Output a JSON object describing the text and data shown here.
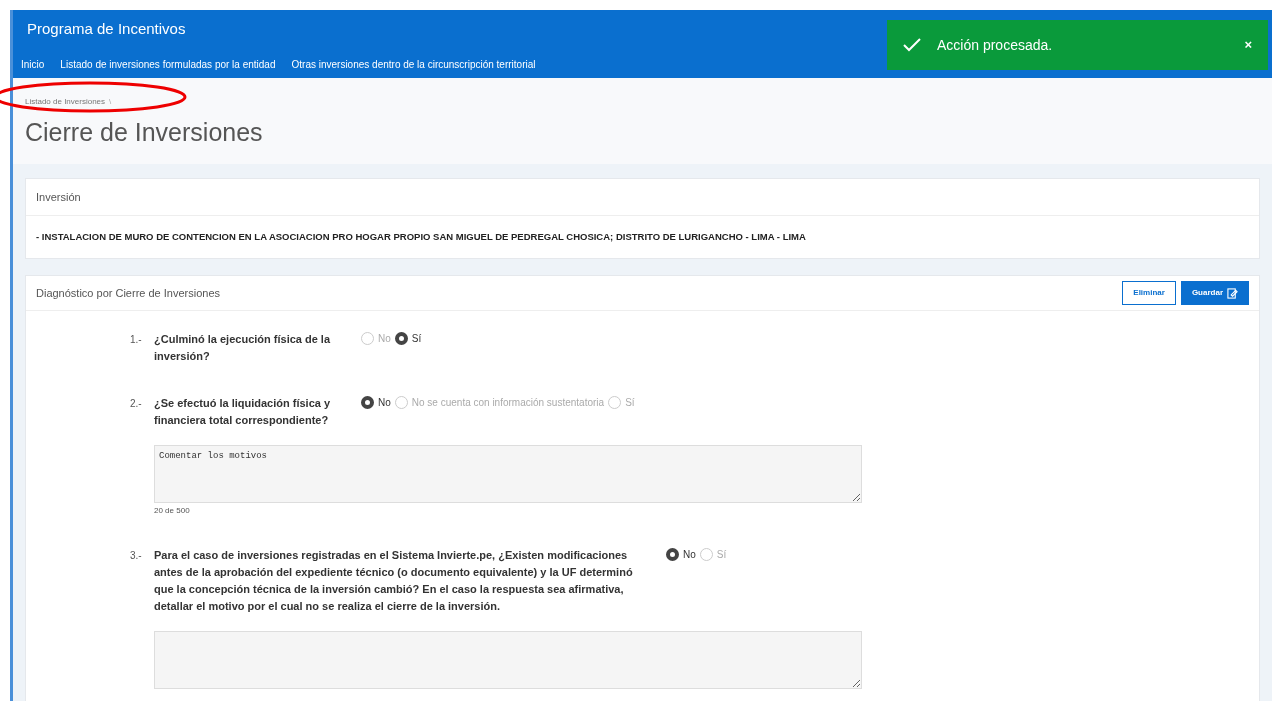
{
  "header": {
    "title": "Programa de Incentivos",
    "nav": [
      "Inicio",
      "Listado de inversiones formuladas por la entidad",
      "Otras inversiones dentro de la circunscripción territorial"
    ]
  },
  "toast": {
    "message": "Acción procesada.",
    "close": "×"
  },
  "breadcrumb": {
    "items": [
      "Listado de Inversiones"
    ],
    "separator": "\\"
  },
  "page_title": "Cierre de Inversiones",
  "investment": {
    "label": "Inversión",
    "value": "- INSTALACION DE MURO DE CONTENCION EN LA ASOCIACION PRO HOGAR PROPIO SAN MIGUEL DE PEDREGAL CHOSICA; DISTRITO DE LURIGANCHO - LIMA - LIMA"
  },
  "diagnosis": {
    "title": "Diagnóstico por Cierre de Inversiones",
    "buttons": [
      {
        "label": "Eliminar",
        "kind": "outline"
      },
      {
        "label": "Guardar",
        "kind": "primary"
      }
    ],
    "questions": [
      {
        "number": "1.-",
        "text": "¿Culminó la ejecución física de la inversión?",
        "kind": "short",
        "options": [
          {
            "label": "No",
            "selected": false
          },
          {
            "label": "Sí",
            "selected": true
          }
        ]
      },
      {
        "number": "2.-",
        "text": "¿Se efectuó la liquidación física y financiera total correspondiente?",
        "kind": "short",
        "options": [
          {
            "label": "No",
            "selected": true
          },
          {
            "label": "No se cuenta con información sustentatoria",
            "selected": false
          },
          {
            "label": "Sí",
            "selected": false
          }
        ],
        "comment": {
          "value": "Comentar los motivos",
          "counter": "20 de 500"
        }
      },
      {
        "number": "3.-",
        "text": "Para el caso de inversiones registradas en el Sistema Invierte.pe, ¿Existen modificaciones antes de la aprobación del expediente técnico (o documento equivalente) y la UF determinó que la concepción técnica de la inversión cambió? En el caso la respuesta sea afirmativa, detallar el motivo por el cual no se realiza el cierre de la inversión.",
        "kind": "long",
        "options": [
          {
            "label": "No",
            "selected": true
          },
          {
            "label": "Sí",
            "selected": false
          }
        ],
        "comment_box": true
      }
    ]
  }
}
